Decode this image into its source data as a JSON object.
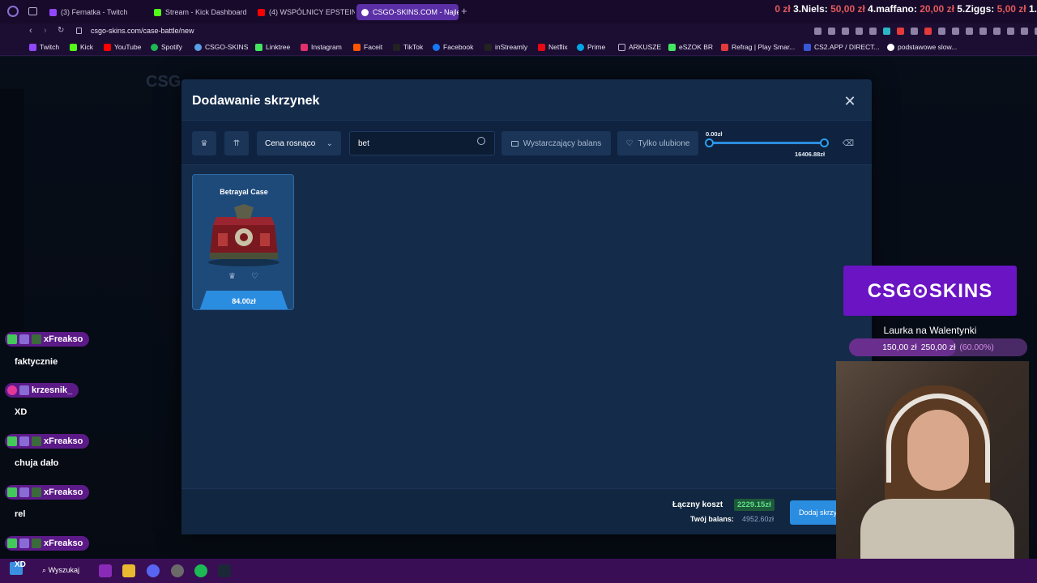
{
  "browser": {
    "tabs": [
      {
        "label": "(3) Fernatka - Twitch",
        "active": false
      },
      {
        "label": "Stream - Kick Dashboard",
        "active": false
      },
      {
        "label": "(4) WSPÓLNICY EPSTEIN",
        "active": false
      },
      {
        "label": "CSGO-SKINS.COM - Najle",
        "active": true
      }
    ],
    "url": "csgo-skins.com/case-battle/new",
    "bookmarks": [
      "Twitch",
      "Kick",
      "YouTube",
      "Spotify",
      "CSGO-SKINS",
      "Linktree",
      "Instagram",
      "Faceit",
      "TikTok",
      "Facebook",
      "inStreamly",
      "Netflix",
      "Prime",
      "ARKUSZE",
      "eSZOK BR",
      "Refrag | Play Smar...",
      "CS2.APP / DIRECT...",
      "podstawowe slow..."
    ]
  },
  "ticker": {
    "items": [
      {
        "rank": "",
        "name": "",
        "value": "0 zł"
      },
      {
        "rank": "3.",
        "name": "Niels:",
        "value": "50,00 zł"
      },
      {
        "rank": "4.",
        "name": "maffano:",
        "value": "20,00 zł"
      },
      {
        "rank": "5.",
        "name": "Ziggs:",
        "value": "5,00 zł"
      },
      {
        "rank": "1.",
        "name": "",
        "value": ""
      }
    ]
  },
  "modal": {
    "title": "Dodawanie skrzynek",
    "sort_label": "Cena rosnąco",
    "search_value": "bet",
    "balance_filter_label": "Wystarczający balans",
    "favorites_filter_label": "Tylko ulubione",
    "price_min": "0.00zł",
    "price_max": "16406.88zł",
    "price_range_fraction": [
      0,
      1
    ],
    "cases": [
      {
        "name": "Betrayal Case",
        "price": "84.00zł"
      }
    ],
    "footer": {
      "total_label": "Łączny koszt",
      "total_value": "2229.15zł",
      "balance_label": "Twój balans:",
      "balance_value": "4952.60zł",
      "add_button_label": "Dodaj skrzynki"
    }
  },
  "chat": [
    {
      "user": "xFreakso",
      "message": "faktycznie"
    },
    {
      "user": "krzesnik_",
      "message": "XD"
    },
    {
      "user": "xFreakso",
      "message": "chuja dało"
    },
    {
      "user": "xFreakso",
      "message": "rel"
    },
    {
      "user": "xFreakso",
      "message": ""
    }
  ],
  "overlay": {
    "logo_text": "CSG⊙SKINS",
    "goal_title": "Laurka na Walentynki",
    "goal_current": "150,00 zł",
    "goal_target": "250,00 zł",
    "goal_percent": "(60.00%)"
  },
  "taskbar": {
    "search_label": "Wyszukaj",
    "start_label": "XD"
  },
  "colors": {
    "accent": "#2a8de0",
    "modal_bg": "#142b4a",
    "purple": "#6a14c4",
    "positive": "#5fe08a"
  }
}
